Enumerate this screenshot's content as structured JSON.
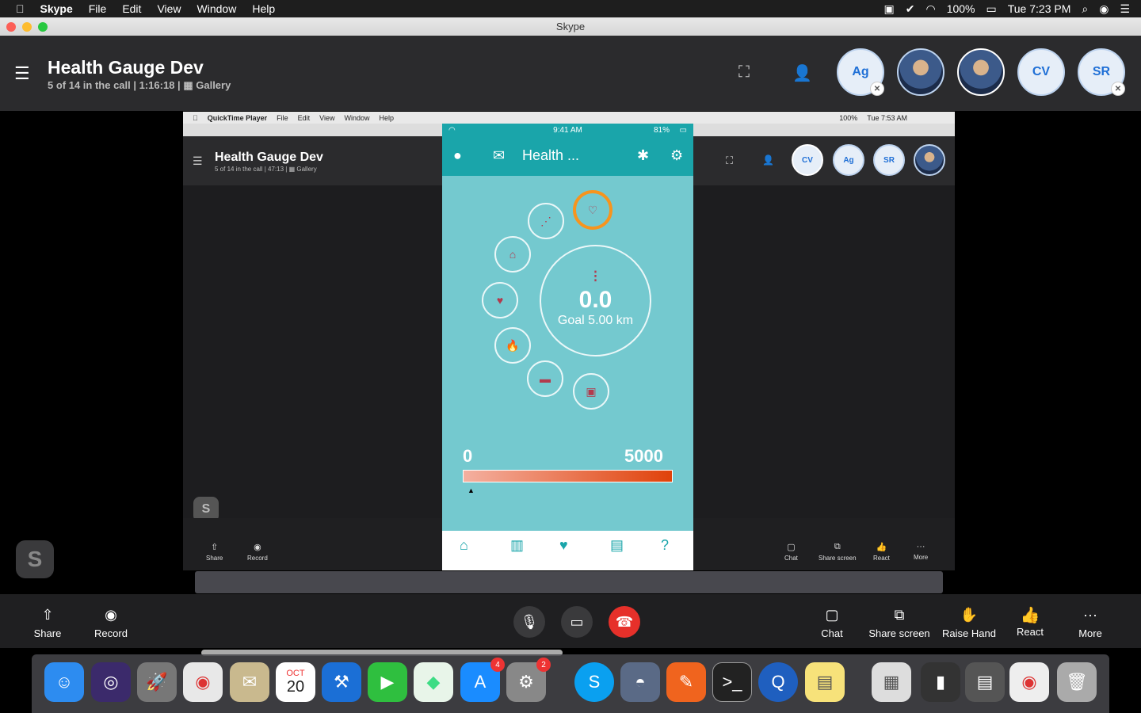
{
  "menubar": {
    "apple": "",
    "app": "Skype",
    "items": [
      "File",
      "Edit",
      "View",
      "Window",
      "Help"
    ],
    "battery": "100%",
    "clock": "Tue 7:23 PM"
  },
  "window": {
    "title": "Skype"
  },
  "call": {
    "title": "Health Gauge Dev",
    "subtitle": "5 of 14 in the call | 1:16:18 |",
    "gallery": "Gallery"
  },
  "avatars": [
    {
      "initials": "Ag",
      "muted": true
    },
    {
      "initials": "",
      "photo": true
    },
    {
      "initials": "",
      "photo": true
    },
    {
      "initials": "CV"
    },
    {
      "initials": "SR",
      "muted": true
    }
  ],
  "toolbar": {
    "share": "Share",
    "record": "Record",
    "chat": "Chat",
    "share_screen": "Share screen",
    "raise_hand": "Raise Hand",
    "react": "React",
    "more": "More"
  },
  "inner": {
    "qt_app": "QuickTime Player",
    "qt_menu": [
      "File",
      "Edit",
      "View",
      "Window",
      "Help"
    ],
    "qt_battery": "100%",
    "qt_clock": "Tue 7:53 AM",
    "title": "Health Gauge Dev",
    "subtitle": "5 of 14 in the call | 47:13 |",
    "gallery": "Gallery",
    "avatars": [
      "CV",
      "Ag",
      "SR"
    ],
    "share": "Share",
    "record": "Record",
    "chat": "Chat",
    "share_screen": "Share screen",
    "react": "React",
    "more": "More"
  },
  "phone": {
    "time": "9:41 AM",
    "battery": "81%",
    "title": "Health ...",
    "distance": "0.0",
    "goal": "Goal 5.00 km",
    "range_min": "0",
    "range_max": "5000",
    "progress": 0
  },
  "dock": {
    "calendar_month": "OCT",
    "calendar_day": "20",
    "appstore_badge": "4",
    "prefs_badge": "2"
  }
}
